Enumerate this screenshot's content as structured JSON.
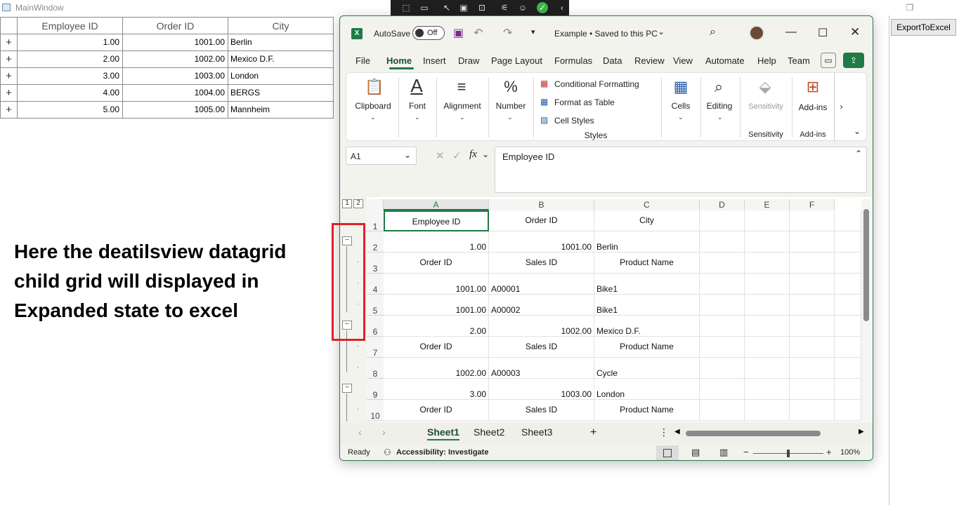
{
  "main_window": {
    "title": "MainWindow",
    "export_button": "ExportToExcel",
    "annotation": "Here the deatilsview datagrid child grid will displayed in Expanded state to excel",
    "grid": {
      "columns": [
        "Employee ID",
        "Order ID",
        "City"
      ],
      "rows": [
        {
          "expander": "+",
          "employee_id": "1.00",
          "order_id": "1001.00",
          "city": "Berlin"
        },
        {
          "expander": "+",
          "employee_id": "2.00",
          "order_id": "1002.00",
          "city": "Mexico D.F."
        },
        {
          "expander": "+",
          "employee_id": "3.00",
          "order_id": "1003.00",
          "city": "London"
        },
        {
          "expander": "+",
          "employee_id": "4.00",
          "order_id": "1004.00",
          "city": "BERGS"
        },
        {
          "expander": "+",
          "employee_id": "5.00",
          "order_id": "1005.00",
          "city": "Mannheim"
        }
      ]
    }
  },
  "excel": {
    "autosave_label": "AutoSave",
    "autosave_state": "Off",
    "file_title": "Example • Saved to this PC",
    "tabs": [
      "File",
      "Home",
      "Insert",
      "Draw",
      "Page Layout",
      "Formulas",
      "Data",
      "Review",
      "View",
      "Automate",
      "Help",
      "Team"
    ],
    "active_tab": "Home",
    "ribbon": {
      "clipboard": "Clipboard",
      "font": "Font",
      "alignment": "Alignment",
      "number": "Number",
      "conditional_formatting": "Conditional Formatting",
      "format_as_table": "Format as Table",
      "cell_styles": "Cell Styles",
      "styles_group": "Styles",
      "cells": "Cells",
      "editing": "Editing",
      "sensitivity": "Sensitivity",
      "sensitivity_group": "Sensitivity",
      "addins": "Add-ins",
      "addins_group": "Add-ins"
    },
    "name_box": "A1",
    "formula_value": "Employee ID",
    "outline_levels": [
      "1",
      "2"
    ],
    "columns": [
      "A",
      "B",
      "C",
      "D",
      "E",
      "F"
    ],
    "rows": [
      {
        "num": "1",
        "a": "Employee ID",
        "b": "Order ID",
        "c": "City",
        "kind": "header"
      },
      {
        "num": "2",
        "a": "1.00",
        "b": "1001.00",
        "c": "Berlin",
        "kind": "data"
      },
      {
        "num": "3",
        "a": "Order ID",
        "b": "Sales ID",
        "c": "Product Name",
        "kind": "header"
      },
      {
        "num": "4",
        "a": "1001.00",
        "b": "A00001",
        "c": "Bike1",
        "kind": "child"
      },
      {
        "num": "5",
        "a": "1001.00",
        "b": "A00002",
        "c": "Bike1",
        "kind": "child"
      },
      {
        "num": "6",
        "a": "2.00",
        "b": "1002.00",
        "c": "Mexico D.F.",
        "kind": "data"
      },
      {
        "num": "7",
        "a": "Order ID",
        "b": "Sales ID",
        "c": "Product Name",
        "kind": "header"
      },
      {
        "num": "8",
        "a": "1002.00",
        "b": "A00003",
        "c": "Cycle",
        "kind": "child"
      },
      {
        "num": "9",
        "a": "3.00",
        "b": "1003.00",
        "c": "London",
        "kind": "data"
      },
      {
        "num": "10",
        "a": "Order ID",
        "b": "Sales ID",
        "c": "Product Name",
        "kind": "header"
      }
    ],
    "sheets": [
      "Sheet1",
      "Sheet2",
      "Sheet3"
    ],
    "active_sheet": "Sheet1",
    "status_ready": "Ready",
    "status_accessibility": "Accessibility: Investigate",
    "zoom": "100%"
  }
}
